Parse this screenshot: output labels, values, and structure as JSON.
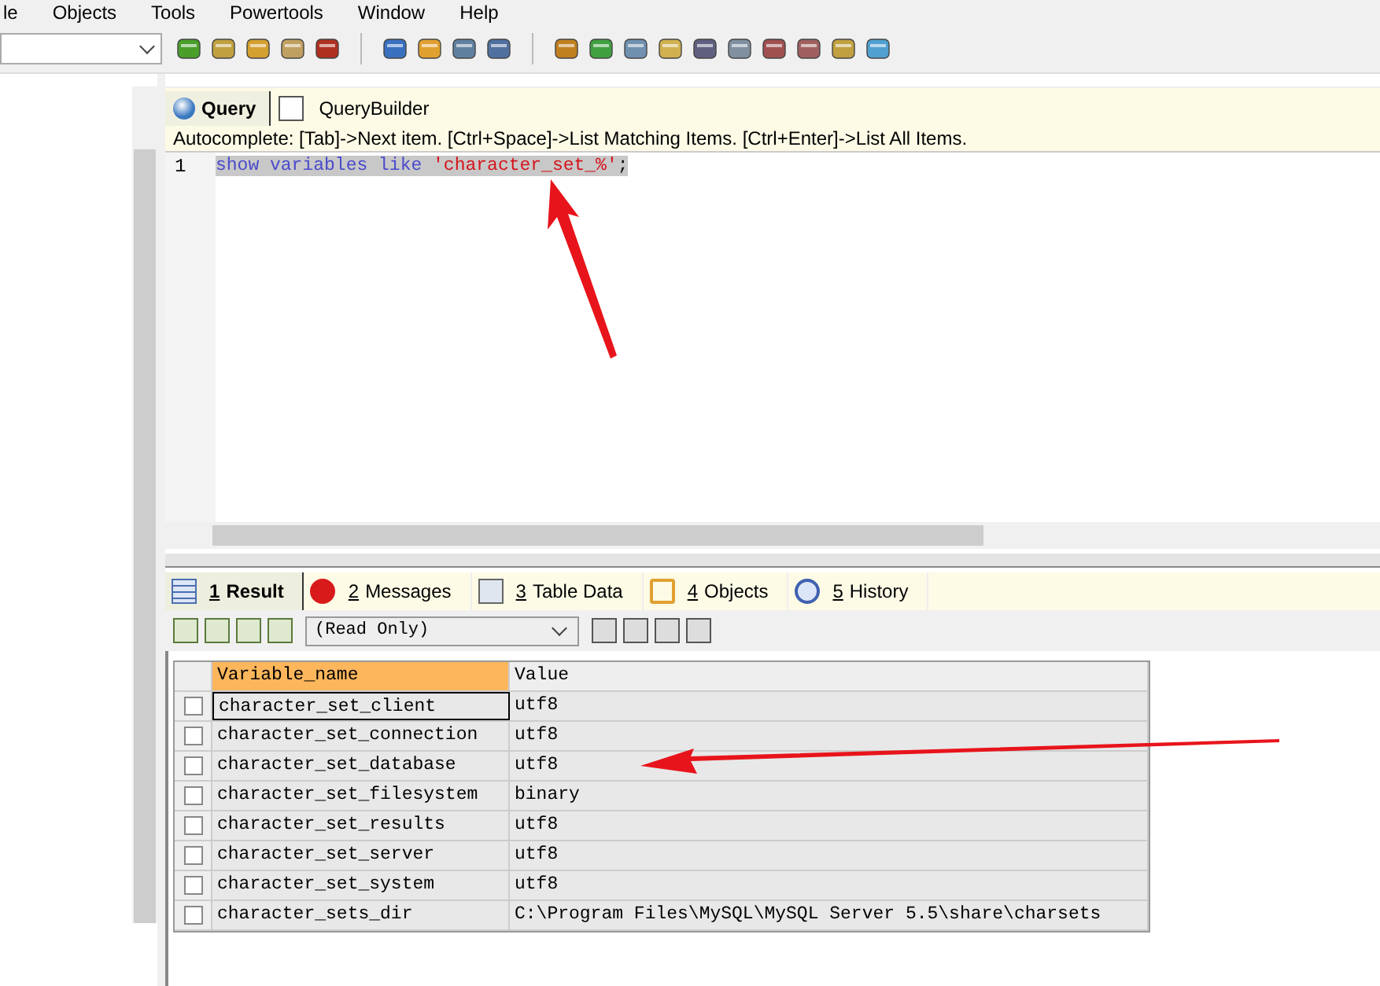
{
  "menu": [
    "le",
    "Objects",
    "Tools",
    "Powertools",
    "Window",
    "Help"
  ],
  "query_tabs": [
    {
      "label": "Query",
      "selected": true
    },
    {
      "label": "QueryBuilder",
      "selected": false
    }
  ],
  "autocomplete_hint": "Autocomplete: [Tab]->Next item. [Ctrl+Space]->List Matching Items. [Ctrl+Enter]->List All Items.",
  "editor": {
    "lines": [
      {
        "number": "1",
        "selected": true,
        "tokens": [
          {
            "kind": "keyword",
            "text": "show variables like"
          },
          {
            "kind": "string",
            "text": "'character_set_%'"
          },
          {
            "kind": "plain",
            "text": ";"
          }
        ]
      }
    ]
  },
  "result_tabs": [
    {
      "number": "1",
      "label": "Result",
      "selected": true
    },
    {
      "number": "2",
      "label": "Messages",
      "selected": false
    },
    {
      "number": "3",
      "label": "Table Data",
      "selected": false
    },
    {
      "number": "4",
      "label": "Objects",
      "selected": false
    },
    {
      "number": "5",
      "label": "History",
      "selected": false
    }
  ],
  "result_mode": "(Read Only)",
  "table": {
    "columns": [
      "Variable_name",
      "Value"
    ],
    "rows": [
      {
        "checked": false,
        "selected": true,
        "cells": [
          "character_set_client",
          "utf8"
        ]
      },
      {
        "checked": false,
        "selected": false,
        "cells": [
          "character_set_connection",
          "utf8"
        ]
      },
      {
        "checked": false,
        "selected": false,
        "cells": [
          "character_set_database",
          "utf8"
        ]
      },
      {
        "checked": false,
        "selected": false,
        "cells": [
          "character_set_filesystem",
          "binary"
        ]
      },
      {
        "checked": false,
        "selected": false,
        "cells": [
          "character_set_results",
          "utf8"
        ]
      },
      {
        "checked": false,
        "selected": false,
        "cells": [
          "character_set_server",
          "utf8"
        ]
      },
      {
        "checked": false,
        "selected": false,
        "cells": [
          "character_set_system",
          "utf8"
        ]
      },
      {
        "checked": false,
        "selected": false,
        "cells": [
          "character_sets_dir",
          "C:\\Program Files\\MySQL\\MySQL Server 5.5\\share\\charsets"
        ]
      }
    ]
  }
}
